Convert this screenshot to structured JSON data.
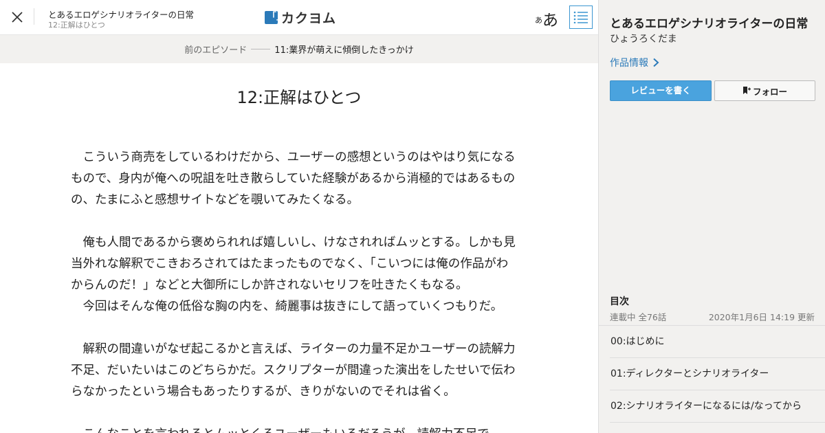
{
  "header": {
    "work_title": "とあるエロゲシナリオライターの日常",
    "episode_subtitle": "12:正解はひとつ",
    "logo_text": "カクヨム",
    "logo_mark": "「」",
    "font_size_small": "あ",
    "font_size_large": "あ",
    "close_icon": "close-icon",
    "toc_icon": "list-icon"
  },
  "prev_episode": {
    "label": "前のエピソード",
    "title": "11:業界が萌えに傾倒したきっかけ"
  },
  "episode": {
    "title": "12:正解はひとつ",
    "paragraphs": [
      "　こういう商売をしているわけだから、ユーザーの感想というのはやはり気になるもので、身内が俺への呪詛を吐き散らしていた経験があるから消極的ではあるものの、たまにふと感想サイトなどを覗いてみたくなる。",
      "",
      "　俺も人間であるから褒められれば嬉しいし、けなされればムッとする。しかも見当外れな解釈でこきおろされてはたまったものでなく、「こいつには俺の作品がわからんのだ！」などと大御所にしか許されないセリフを吐きたくもなる。",
      "　今回はそんな俺の低俗な胸の内を、綺麗事は抜きにして語っていくつもりだ。",
      "",
      "　解釈の間違いがなぜ起こるかと言えば、ライターの力量不足かユーザーの読解力不足、だいたいはこのどちらかだ。スクリプターが間違った演出をしたせいで伝わらなかったという場合もあったりするが、きりがないのでそれは省く。",
      "",
      "　こんなことを言われるとムッとくるユーザーもいるだろうが、読解力不足で"
    ]
  },
  "sidebar": {
    "title": "とあるエロゲシナリオライターの日常",
    "author": "ひょうろくだま",
    "work_info_label": "作品情報",
    "review_button": "レビューを書く",
    "follow_button": "フォロー",
    "toc_heading": "目次",
    "toc_status": "連載中 全76話",
    "toc_updated": "2020年1月6日 14:19 更新",
    "episodes": [
      "00:はじめに",
      "01:ディレクターとシナリオライター",
      "02:シナリオライターになるには/なってから"
    ]
  },
  "colors": {
    "accent": "#2b7ab9",
    "review_button": "#4aa3de",
    "sidebar_bg": "#f2f1ef",
    "prevbar_bg": "#f2f1ef"
  }
}
